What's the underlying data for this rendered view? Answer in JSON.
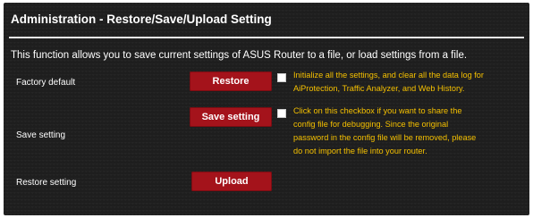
{
  "title": "Administration - Restore/Save/Upload Setting",
  "description": "This function allows you to save current settings of ASUS Router to a file, or load settings from a file.",
  "rows": [
    {
      "label": "Factory default",
      "button": "Restore",
      "note_lines": [
        "Initialize all the settings, and clear all the data log for",
        "AiProtection, Traffic Analyzer, and Web History."
      ]
    },
    {
      "label": "Save setting",
      "button": "Save setting",
      "note_lines": [
        "Click on this checkbox if you want to share the",
        "config file for debugging. Since the original",
        "password in the config file will be removed, please",
        "do not import the file into your router."
      ]
    },
    {
      "label": "Restore setting",
      "button": "Upload"
    }
  ],
  "colors": {
    "panel_bg": "#1e1e1e",
    "button_bg": "#a4131b",
    "note_text": "#f5c000"
  }
}
